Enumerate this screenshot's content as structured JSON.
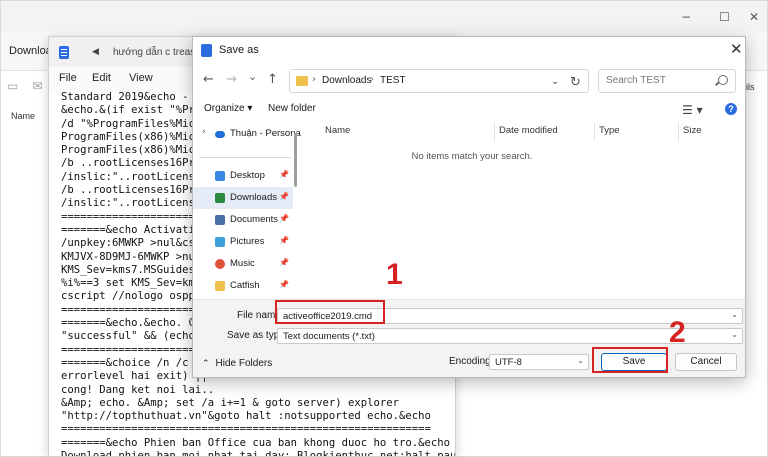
{
  "explorer": {
    "address_text": "Download",
    "name_header": "Name",
    "right_label": "ils",
    "window_controls": [
      "−",
      "☐",
      "✕"
    ]
  },
  "notepad": {
    "back_arrow": "◀",
    "tab1": "hướng dẫn c",
    "tab2": "treas",
    "menu": {
      "file": "File",
      "edit": "Edit",
      "view": "View"
    },
    "lines": [
      "Standard 2019&echo - Mic",
      "&echo.&(if exist \"%Prograr",
      "/d \"%ProgramFiles%Microsc",
      "ProgramFiles(x86)%Micros",
      "ProgramFiles(x86)%Micros",
      "/b ..rootLicenses16ProPl",
      "/inslic:\"..rootLicenses1",
      "/b ..rootLicenses16ProPl",
      "/inslic:\"..rootLicenses1",
      "==========================",
      "=======&echo Activating",
      "/unpkey:6MWKP >nul&cscri",
      "KMJVX-8D9MJ-6MWKP >nul&s",
      "KMS_Sev=kms7.MSGuides.cc",
      "%i%==3 set KMS_Sev=kms9.",
      "cscript //nologo ospp.vb",
      "==========================",
      "=======&echo.&echo. Csc",
      "\"successful\" && (echo.&e",
      "==========================",
      "=======&choice /n /c YN",
      "errorlevel hai exit) ||",
      "cong! Dang ket noi lai..",
      "&Amp; echo. &Amp; set /a i+=1 & goto server) explorer",
      "\"http://topthuthuat.vn\"&goto halt :notsupported echo.&echo",
      "==========================================================",
      "=======&echo Phien ban Office cua ban khong duoc ho tro.&echo",
      "Download phien ban moi nhat tai day: Blogkienthuc.net:halt pause >"
    ]
  },
  "dialog": {
    "title": "Save as",
    "close_glyph": "✕",
    "nav": {
      "back": "←",
      "forward": "→",
      "recent": "⌄",
      "up": "↑"
    },
    "breadcrumb": [
      "Downloads",
      "TEST"
    ],
    "breadcrumb_sep": "›",
    "search_placeholder": "Search TEST",
    "organize": "Organize ▾",
    "new_folder": "New folder",
    "view_glyph": "☰ ▾",
    "help_glyph": "?",
    "nav_pane": [
      {
        "label": "Thuận - Persona",
        "icon": "cloud-icon",
        "color": "#1f6fd6"
      },
      {
        "label": "Desktop",
        "icon": "desktop-icon",
        "color": "#3a86e6"
      },
      {
        "label": "Downloads",
        "icon": "download-icon",
        "color": "#2b8a3e"
      },
      {
        "label": "Documents",
        "icon": "documents-icon",
        "color": "#4a6fa5"
      },
      {
        "label": "Pictures",
        "icon": "pictures-icon",
        "color": "#3aa0d6"
      },
      {
        "label": "Music",
        "icon": "music-icon",
        "color": "#e0533b"
      },
      {
        "label": "Catfish",
        "icon": "folder-icon",
        "color": "#f0c14b"
      }
    ],
    "columns": [
      "Name",
      "Date modified",
      "Type",
      "Size"
    ],
    "empty_message": "No items match your search.",
    "file_name_label": "File name:",
    "file_name_value": "activeoffice2019.cmd",
    "save_type_label": "Save as type:",
    "save_type_value": "Text documents (*.txt)",
    "hide_folders": "Hide Folders",
    "encoding_label": "Encoding:",
    "encoding_value": "UTF-8",
    "save_button": "Save",
    "cancel_button": "Cancel"
  },
  "annotations": {
    "step1": "1",
    "step2": "2",
    "color": "#d62222"
  }
}
